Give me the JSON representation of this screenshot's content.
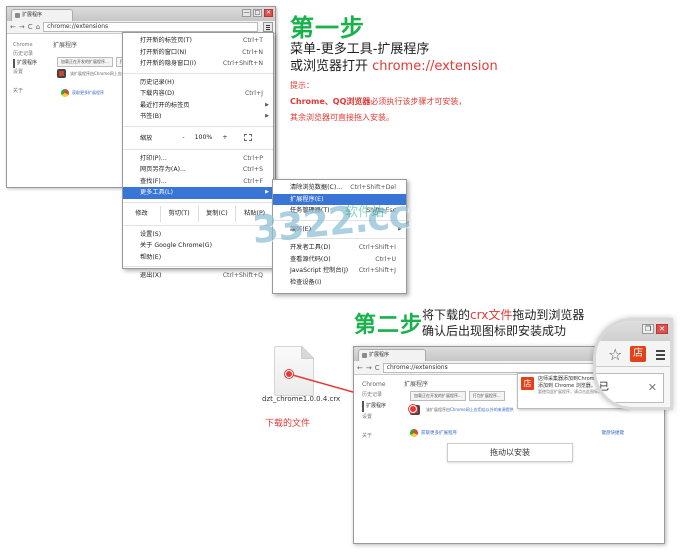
{
  "step1": {
    "heading": "第一步",
    "line1": "菜单-更多工具-扩展程序",
    "line2_prefix": "或浏览器打开 ",
    "line2_url": "chrome://extension",
    "tip_heading": "提示：",
    "tip_line1_bold": "Chrome、QQ浏览器",
    "tip_line1_rest": "必须执行该步骤才可安装，",
    "tip_line2": "其余浏览器可直接拖入安装。"
  },
  "browser1": {
    "tab_title": "扩展程序",
    "window_buttons": [
      "—",
      "□",
      "✕"
    ],
    "nav": [
      "←",
      "→",
      "C",
      "⌂"
    ],
    "address": "chrome://extensions",
    "sidebar_title": "Chrome",
    "sidebar_items": [
      "历史记录",
      "扩展程序",
      "设置"
    ],
    "sidebar_about": "关于",
    "page_title": "扩展程序",
    "buttons": [
      "加载正在开发的扩展程序...",
      "打包扩展程序..."
    ],
    "item_text": "该扩展程序由Chrome网上应用店以外的来源提供",
    "get_more": "获取更多扩展程序"
  },
  "menu": {
    "items_top": [
      {
        "label": "打开新的标签页(T)",
        "shortcut": "Ctrl+T"
      },
      {
        "label": "打开新的窗口(N)",
        "shortcut": "Ctrl+N"
      },
      {
        "label": "打开新的隐身窗口(I)",
        "shortcut": "Ctrl+Shift+N"
      }
    ],
    "items_history": [
      {
        "label": "历史记录(H)",
        "shortcut": ""
      },
      {
        "label": "下载内容(D)",
        "shortcut": "Ctrl+J"
      },
      {
        "label": "最近打开的标签页",
        "shortcut": ""
      },
      {
        "label": "书签(B)",
        "shortcut": ""
      }
    ],
    "zoom": {
      "label": "缩放",
      "minus": "-",
      "value": "100%",
      "plus": "+"
    },
    "items_print": [
      {
        "label": "打印(P)...",
        "shortcut": "Ctrl+P"
      },
      {
        "label": "网页另存为(A)...",
        "shortcut": "Ctrl+S"
      },
      {
        "label": "查找(F)...",
        "shortcut": "Ctrl+F"
      }
    ],
    "more_tools": "更多工具(L)",
    "edit": {
      "label": "修改",
      "cut": "剪切(T)",
      "copy": "复制(C)",
      "paste": "粘贴(P)"
    },
    "items_bottom": [
      {
        "label": "设置(S)",
        "shortcut": ""
      },
      {
        "label": "关于 Google Chrome(G)",
        "shortcut": ""
      },
      {
        "label": "帮助(E)",
        "shortcut": ""
      }
    ],
    "exit": {
      "label": "退出(X)",
      "shortcut": "Ctrl+Shift+Q"
    }
  },
  "submenu": {
    "items": [
      {
        "label": "清除浏览数据(C)...",
        "shortcut": "Ctrl+Shift+Del"
      },
      {
        "label": "扩展程序(E)",
        "shortcut": ""
      },
      {
        "label": "任务管理器(T)",
        "shortcut": "Shift+Esc"
      },
      {
        "label": "",
        "shortcut": ""
      },
      {
        "label": "编码(E)",
        "shortcut": ""
      },
      {
        "label": "开发者工具(D)",
        "shortcut": "Ctrl+Shift+I"
      },
      {
        "label": "查看源代码(O)",
        "shortcut": "Ctrl+U"
      },
      {
        "label": "JavaScript 控制台(J)",
        "shortcut": "Ctrl+Shift+J"
      },
      {
        "label": "检查设备(I)",
        "shortcut": ""
      }
    ]
  },
  "watermark": {
    "text": "3322.cc",
    "cn": "软件站"
  },
  "step2": {
    "heading": "第二步",
    "line1_prefix": "将下载的",
    "line1_red": "crx文件",
    "line1_suffix": "拖动到浏览器",
    "line2": "确认后出现图标即安装成功"
  },
  "file": {
    "name": "dzt_chrome1.0.0.4.crx",
    "caption": "下载的文件"
  },
  "browser2": {
    "tab_title": "扩展程序",
    "nav": [
      "←",
      "→",
      "C"
    ],
    "address": "chrome://extensions",
    "sidebar_title": "Chrome",
    "sidebar_items": [
      "历史记录",
      "扩展程序",
      "设置"
    ],
    "sidebar_about": "关于",
    "page_title": "扩展程序",
    "buttons": [
      "加载正在开发的扩展程序...",
      "打包扩展程序..."
    ],
    "item_text": "该扩展程序由",
    "item_link": "Chrome网上应用店以外的来源提供",
    "get_more": "获取更多扩展程序",
    "right_link": "键盘快捷键",
    "drop_label": "拖动以安装",
    "popup_title": "店师采集器添加到Chrome",
    "popup_line2": "添加到 Chrome 浏览器。",
    "popup_small": "要使用此扩展程序，请点击此图标。"
  },
  "magnifier": {
    "star": "☆",
    "app_icon": "店",
    "popup_text": "已",
    "close": "✕"
  },
  "colors": {
    "green": "#18b24b",
    "red": "#e53935",
    "highlight": "#3875d7"
  }
}
